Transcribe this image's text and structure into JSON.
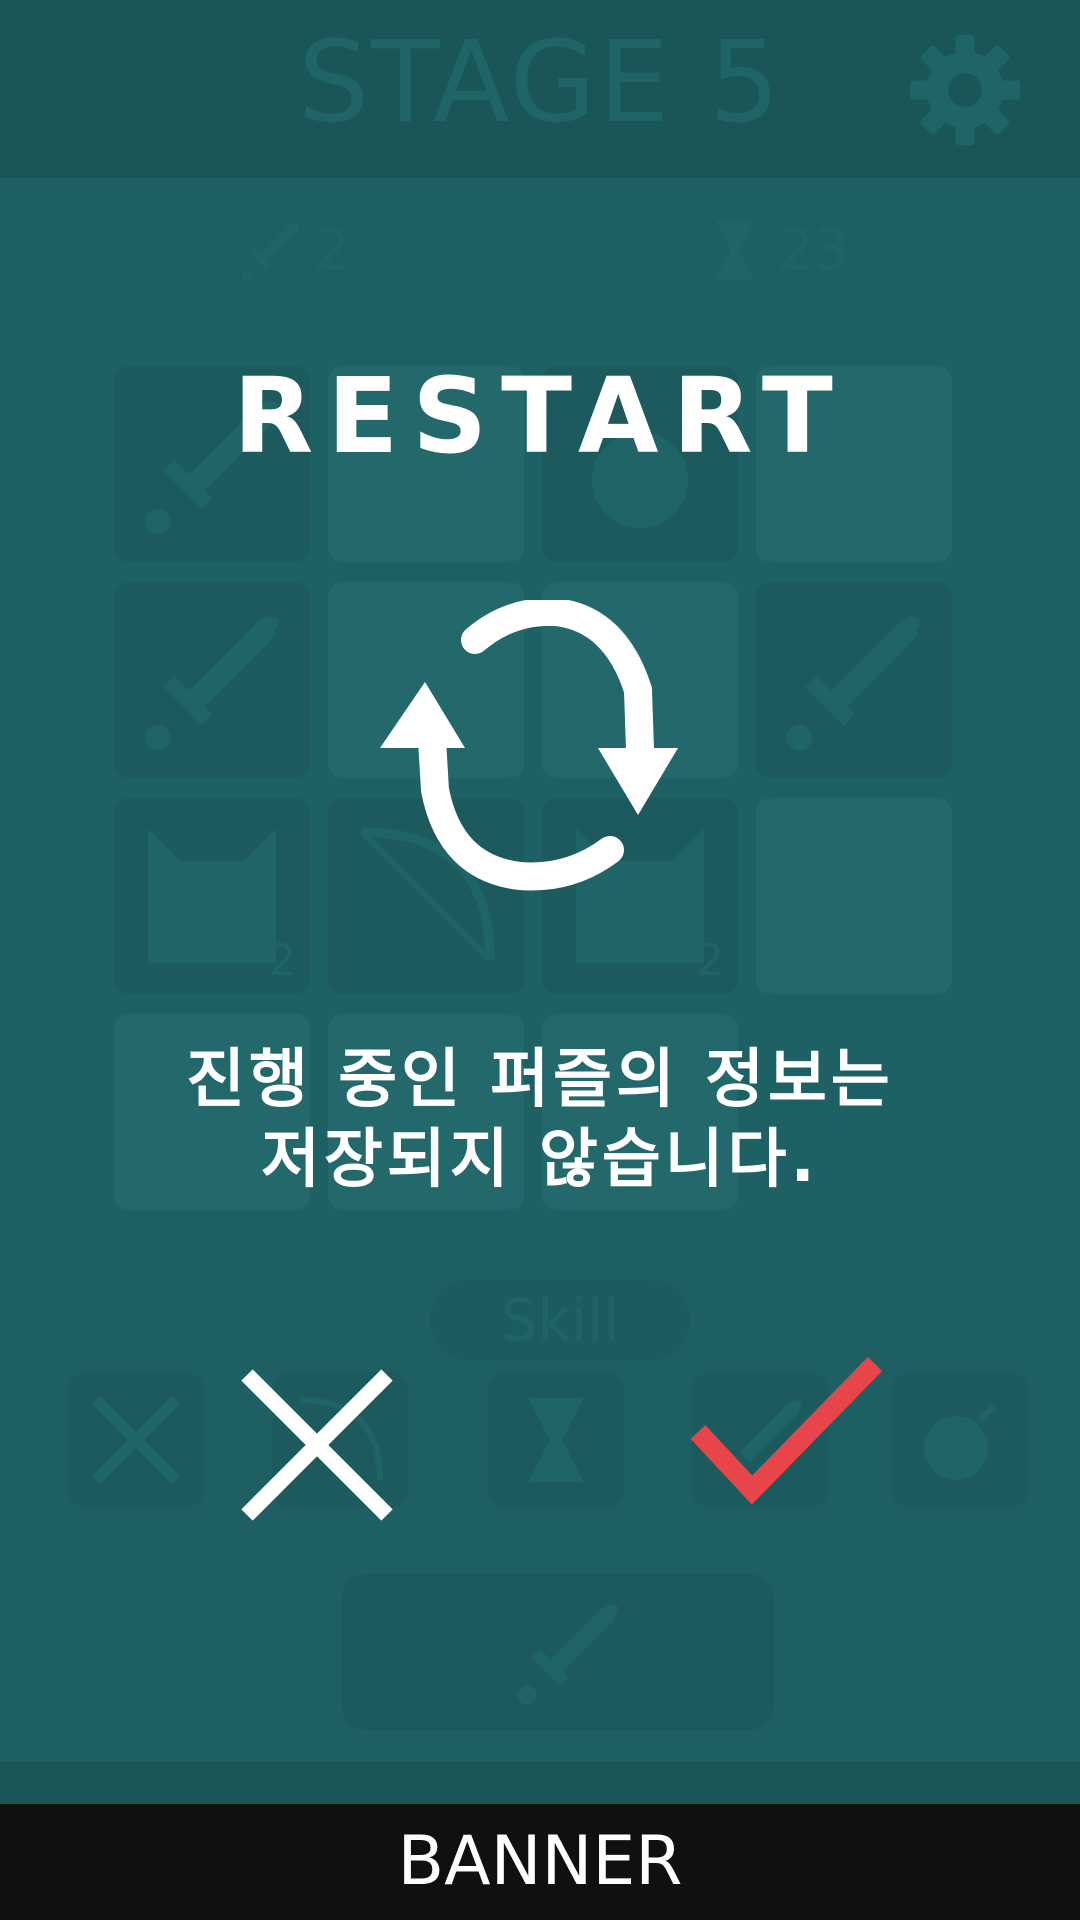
{
  "game": {
    "stage_title": "STAGE 5",
    "stats": {
      "swords": "2",
      "time": "23"
    },
    "tile_badges": [
      "2",
      "2"
    ],
    "skill_label": "Skill"
  },
  "dialog": {
    "title": "RESTART",
    "message_line1": "진행 중인 퍼즐의 정보는",
    "message_line2": "저장되지 않습니다.",
    "cancel_icon": "close-icon",
    "confirm_icon": "check-icon",
    "confirm_color": "#e8454a"
  },
  "banner": {
    "label": "BANNER"
  },
  "colors": {
    "background": "#1d5f62",
    "banner": "#101010",
    "text": "#ffffff"
  }
}
